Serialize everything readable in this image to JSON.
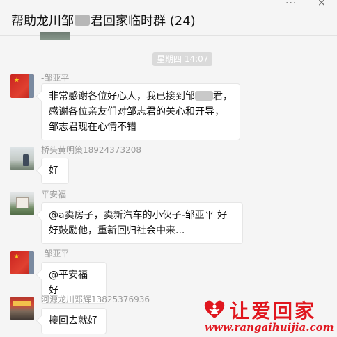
{
  "window": {
    "title_pre": "帮助龙川邹",
    "title_post": "君回家临时群",
    "member_count": "(24)",
    "more_icon": "···",
    "close_icon": "×"
  },
  "chat": {
    "timestamp": "星期四 14:07",
    "messages": [
      {
        "sender": "-邹亚平",
        "avatar": "red-flag-avatar",
        "text_part1": "非常感谢各位好心人，我已接到邹",
        "text_part2": "君，感谢各位亲友们对邹志君的关心和开导，邹志君现在心情不错"
      },
      {
        "sender": "桥头黄明策18924373208",
        "avatar": "photo-avatar",
        "text": "好"
      },
      {
        "sender": "平安福",
        "avatar": "house-photo-avatar",
        "text": "@a卖房子，卖新汽车的小伙子-邹亚平 好好鼓励他，重新回归社会中来..."
      },
      {
        "sender": "-邹亚平",
        "avatar": "red-flag-avatar",
        "text": "@平安福 好"
      },
      {
        "sender": "河源龙川邓辉13825376936",
        "avatar": "shop-photo-avatar",
        "text": "接回去就好"
      }
    ]
  },
  "watermark": {
    "logo_text": "让爱回家",
    "url": "www.rangaihuijia.com",
    "color": "#e0161e"
  }
}
